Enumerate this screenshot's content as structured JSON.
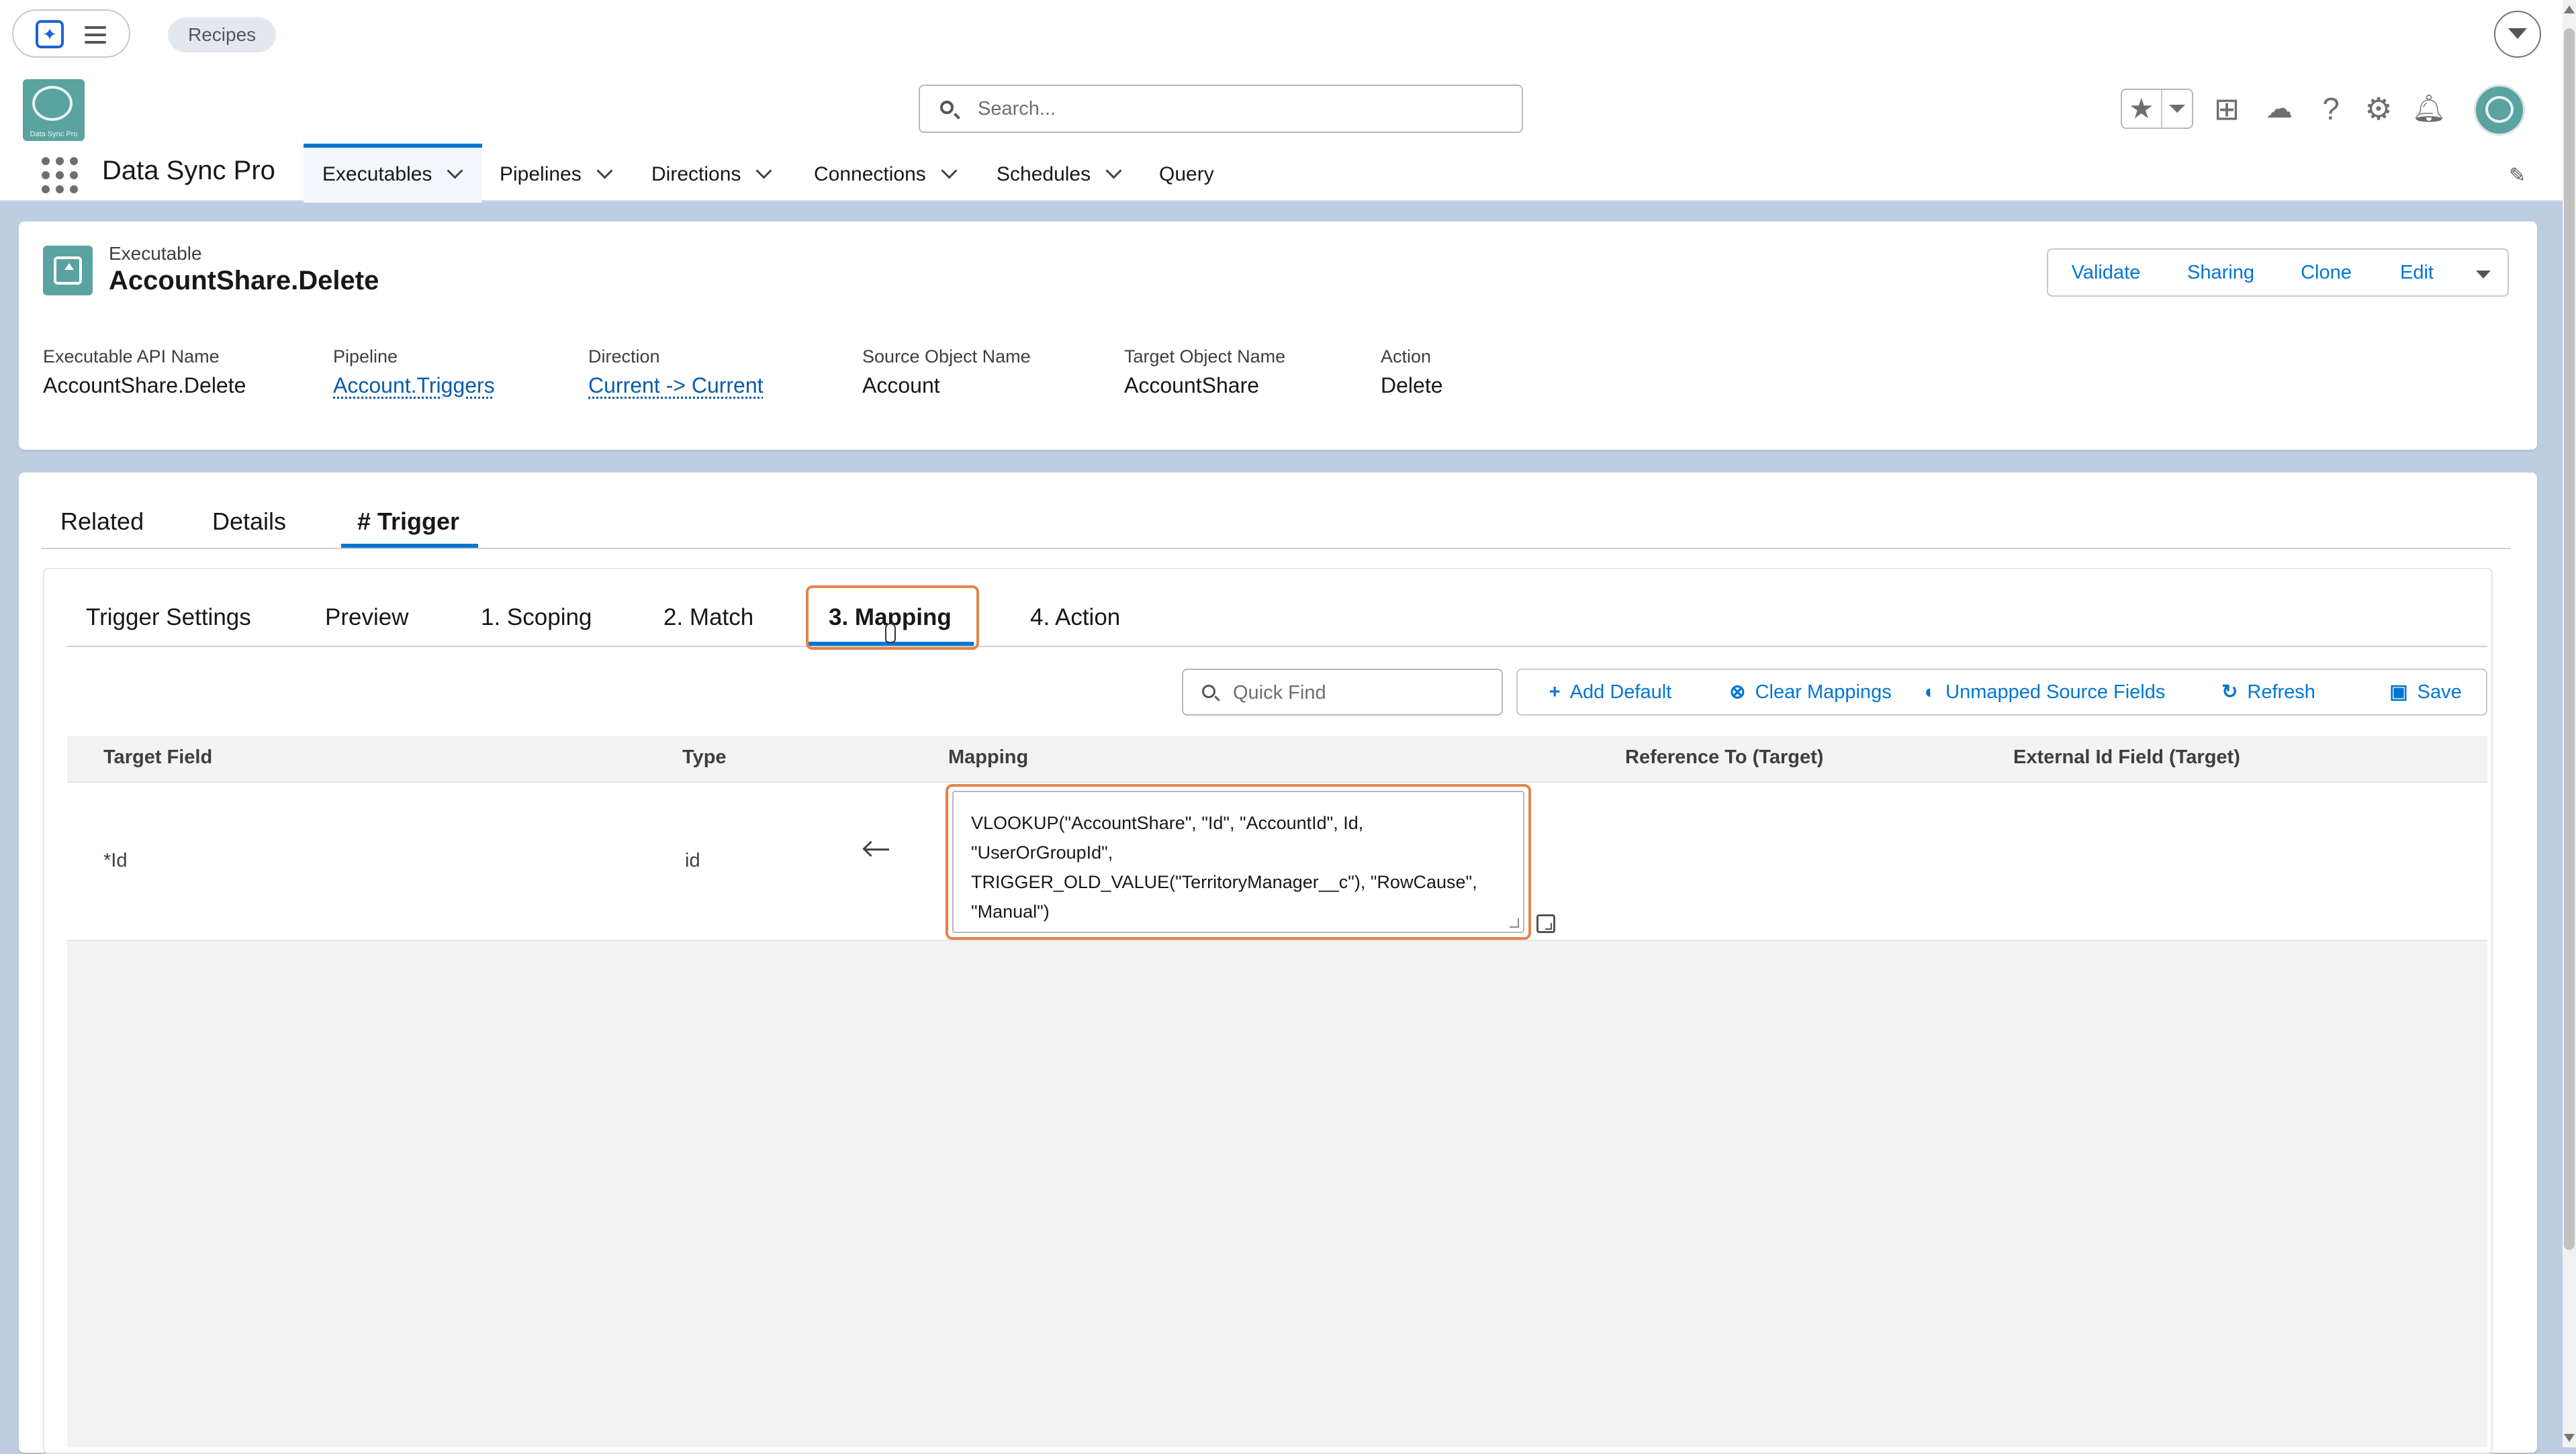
{
  "browser": {
    "recipes_pill": "Recipes"
  },
  "header": {
    "logo_text": "Data Sync Pro",
    "search_placeholder": "Search..."
  },
  "nav": {
    "app_name": "Data Sync Pro",
    "tabs": [
      {
        "label": "Executables",
        "has_menu": true,
        "active": true
      },
      {
        "label": "Pipelines",
        "has_menu": true
      },
      {
        "label": "Directions",
        "has_menu": true
      },
      {
        "label": "Connections",
        "has_menu": true
      },
      {
        "label": "Schedules",
        "has_menu": true
      },
      {
        "label": "Query",
        "has_menu": false
      }
    ]
  },
  "record": {
    "type": "Executable",
    "title": "AccountShare.Delete",
    "actions": [
      "Validate",
      "Sharing",
      "Clone",
      "Edit"
    ],
    "fields": [
      {
        "label": "Executable API Name",
        "value": "AccountShare.Delete",
        "link": false
      },
      {
        "label": "Pipeline",
        "value": "Account.Triggers",
        "link": true
      },
      {
        "label": "Direction",
        "value": "Current -> Current",
        "link": true
      },
      {
        "label": "Source Object Name",
        "value": "Account",
        "link": false
      },
      {
        "label": "Target Object Name",
        "value": "AccountShare",
        "link": false
      },
      {
        "label": "Action",
        "value": "Delete",
        "link": false
      }
    ]
  },
  "page_tabs": [
    {
      "label": "Related"
    },
    {
      "label": "Details"
    },
    {
      "label": "# Trigger",
      "active": true
    }
  ],
  "sub_tabs": [
    {
      "label": "Trigger Settings"
    },
    {
      "label": "Preview"
    },
    {
      "label": "1. Scoping"
    },
    {
      "label": "2. Match"
    },
    {
      "label": "3. Mapping",
      "active": true
    },
    {
      "label": "4. Action"
    }
  ],
  "toolbar": {
    "quick_find_placeholder": "Quick Find",
    "buttons": [
      {
        "label": "Add Default",
        "icon": "plus-icon"
      },
      {
        "label": "Clear Mappings",
        "icon": "clear-icon"
      },
      {
        "label": "Unmapped Source Fields",
        "icon": "toggle-icon"
      },
      {
        "label": "Refresh",
        "icon": "refresh-icon"
      },
      {
        "label": "Save",
        "icon": "save-icon"
      }
    ]
  },
  "table": {
    "columns": [
      "Target Field",
      "Type",
      "Mapping",
      "Reference To (Target)",
      "External Id Field (Target)"
    ],
    "rows": [
      {
        "target_field": "*Id",
        "type": "id",
        "mapping": "VLOOKUP(\"AccountShare\", \"Id\", \"AccountId\", Id,\n\"UserOrGroupId\",\nTRIGGER_OLD_VALUE(\"TerritoryManager__c\"), \"RowCause\",\n\"Manual\")",
        "reference_to": "",
        "external_id_field": ""
      }
    ]
  },
  "colors": {
    "accent": "#0176d3",
    "focus": "#e1844a",
    "brand": "#5aa3a1"
  }
}
